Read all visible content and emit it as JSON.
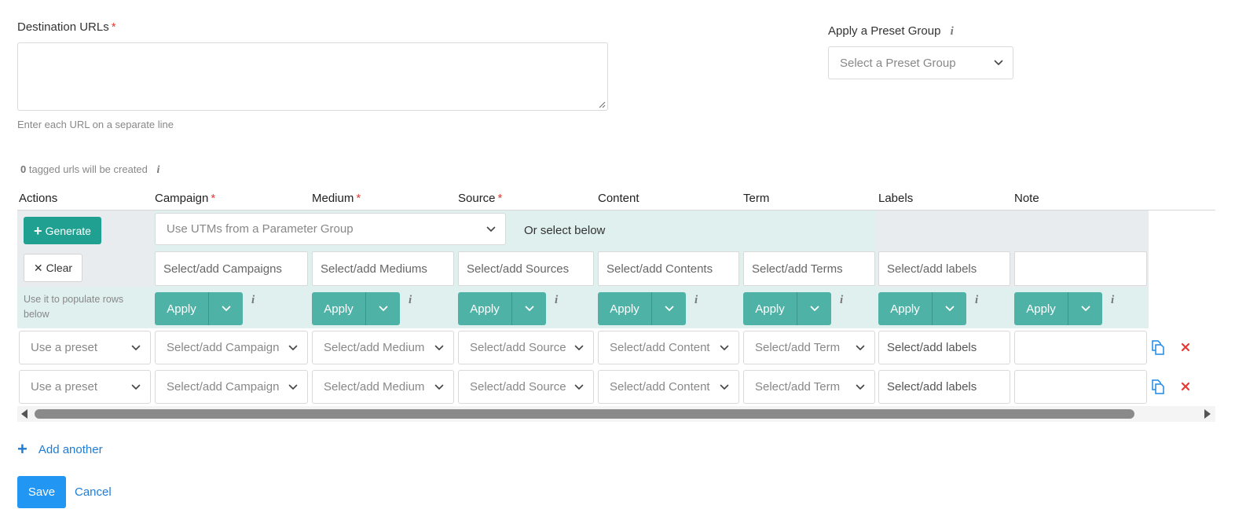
{
  "destination": {
    "label": "Destination URLs",
    "required_mark": "*",
    "hint": "Enter each URL on a separate line",
    "value": ""
  },
  "preset_group": {
    "label": "Apply a Preset Group",
    "info": "i",
    "placeholder": "Select a Preset Group"
  },
  "count": {
    "number": "0",
    "text": "tagged urls will be created",
    "info": "i"
  },
  "columns": {
    "actions": "Actions",
    "campaign": "Campaign",
    "medium": "Medium",
    "source": "Source",
    "content": "Content",
    "term": "Term",
    "labels": "Labels",
    "note": "Note",
    "required_mark": "*"
  },
  "bulk": {
    "generate_label": "Generate",
    "clear_label": "Clear",
    "populate_hint": "Use it to populate rows below",
    "param_group_placeholder": "Use UTMs from a Parameter Group",
    "or_select": "Or select below",
    "inputs": {
      "campaign": "Select/add Campaigns",
      "medium": "Select/add Mediums",
      "source": "Select/add Sources",
      "content": "Select/add Contents",
      "term": "Select/add Terms",
      "labels": "Select/add labels",
      "note": ""
    },
    "apply_label": "Apply",
    "info": "i"
  },
  "rows": [
    {
      "preset": "Use a preset",
      "campaign": "Select/add Campaign",
      "medium": "Select/add Medium",
      "source": "Select/add Source",
      "content": "Select/add Content",
      "term": "Select/add Term",
      "labels": "Select/add labels",
      "note": ""
    },
    {
      "preset": "Use a preset",
      "campaign": "Select/add Campaign",
      "medium": "Select/add Medium",
      "source": "Select/add Source",
      "content": "Select/add Content",
      "term": "Select/add Term",
      "labels": "Select/add labels",
      "note": ""
    }
  ],
  "footer": {
    "add_another": "Add another",
    "save": "Save",
    "cancel": "Cancel"
  },
  "icons": {
    "copy": "copy-icon",
    "delete": "delete-x-icon",
    "chevron": "chevron-down-icon",
    "info": "info-icon"
  },
  "colors": {
    "teal_dark": "#20a090",
    "teal": "#4fb2a6",
    "mint_bg": "#dff0ef",
    "gray_bg": "#e9ecef",
    "blue": "#2196f3",
    "link": "#1e7cd6",
    "required": "#e53935",
    "delete": "#e53935"
  }
}
